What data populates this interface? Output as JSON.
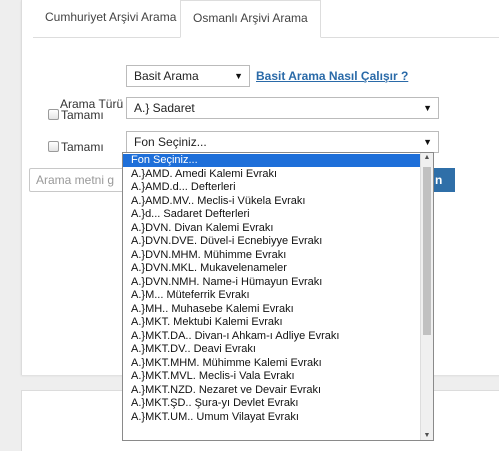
{
  "tabs": [
    {
      "label": "Cumhuriyet Arşivi Arama",
      "active": false
    },
    {
      "label": "Osmanlı Arşivi Arama",
      "active": true
    }
  ],
  "search_type": {
    "label": "Arama Türü",
    "value": "Basit Arama",
    "help_link": "Basit Arama Nasıl Çalışır ?"
  },
  "row1": {
    "checkbox_label": "Tamamı",
    "value": "A.} Sadaret"
  },
  "row2": {
    "checkbox_label": "Tamamı",
    "value": "Fon Seçiniz..."
  },
  "search_input": {
    "placeholder": "Arama metni g"
  },
  "search_button": {
    "label": "n"
  },
  "dropdown_options": [
    "Fon Seçiniz...",
    "A.}AMD. Amedi Kalemi Evrakı",
    "A.}AMD.d... Defterleri",
    "A.}AMD.MV.. Meclis-i Vükela Evrakı",
    "A.}d... Sadaret Defterleri",
    "A.}DVN. Divan Kalemi Evrakı",
    "A.}DVN.DVE. Düvel-i Ecnebiyye Evrakı",
    "A.}DVN.MHM. Mühimme Evrakı",
    "A.}DVN.MKL. Mukavelenameler",
    "A.}DVN.NMH. Name-i Hümayun Evrakı",
    "A.}M... Müteferrik Evrakı",
    "A.}MH.. Muhasebe Kalemi Evrakı",
    "A.}MKT. Mektubi Kalemi Evrakı",
    "A.}MKT.DA.. Divan-ı Ahkam-ı Adliye Evrakı",
    "A.}MKT.DV.. Deavi Evrakı",
    "A.}MKT.MHM. Mühimme Kalemi Evrakı",
    "A.}MKT.MVL. Meclis-i Vala Evrakı",
    "A.}MKT.NZD. Nezaret ve Devair Evrakı",
    "A.}MKT.ŞD.. Şura-yı Devlet Evrakı",
    "A.}MKT.UM.. Umum Vilayat Evrakı"
  ],
  "selected_option": "Fon Seçiniz...",
  "icons": {
    "select_caret": "▼",
    "scroll_up": "▲",
    "scroll_down": "▼"
  },
  "colors": {
    "selected_bg": "#1e6fd9",
    "link": "#2a6aa8",
    "button": "#2f6fa8"
  }
}
